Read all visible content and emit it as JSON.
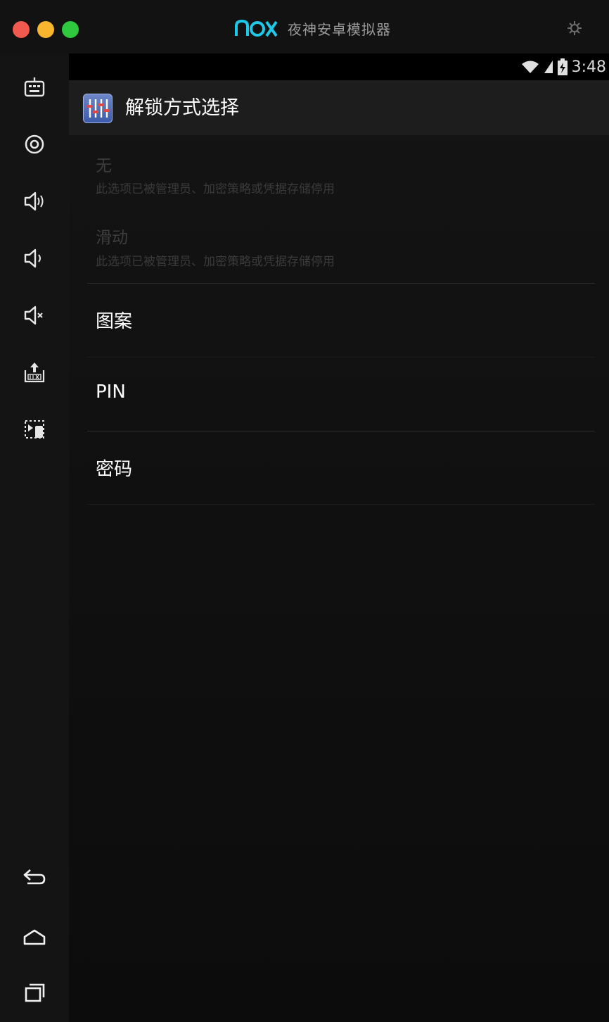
{
  "window": {
    "title": "夜神安卓模拟器",
    "logo_text": "nox",
    "traffic_lights": [
      "close",
      "minimize",
      "zoom"
    ],
    "accent_color": "#1ec8e8"
  },
  "sidebar": {
    "tools": [
      {
        "name": "keyboard-icon"
      },
      {
        "name": "location-icon"
      },
      {
        "name": "volume-up-icon"
      },
      {
        "name": "volume-down-icon"
      },
      {
        "name": "mute-icon"
      },
      {
        "name": "apk-install-icon"
      },
      {
        "name": "screenshot-icon"
      }
    ],
    "nav": [
      {
        "name": "back-icon"
      },
      {
        "name": "home-icon"
      },
      {
        "name": "recents-icon"
      }
    ]
  },
  "status_bar": {
    "time": "3:48",
    "icons": [
      "wifi-icon",
      "signal-icon",
      "battery-icon"
    ]
  },
  "action_bar": {
    "title": "解锁方式选择",
    "icon": "settings-app-icon"
  },
  "options": [
    {
      "title": "无",
      "summary": "此选项已被管理员、加密策略或凭据存储停用",
      "enabled": false
    },
    {
      "title": "滑动",
      "summary": "此选项已被管理员、加密策略或凭据存储停用",
      "enabled": false
    },
    {
      "title": "图案",
      "enabled": true
    },
    {
      "title": "PIN",
      "enabled": true
    },
    {
      "title": "密码",
      "enabled": true
    }
  ]
}
